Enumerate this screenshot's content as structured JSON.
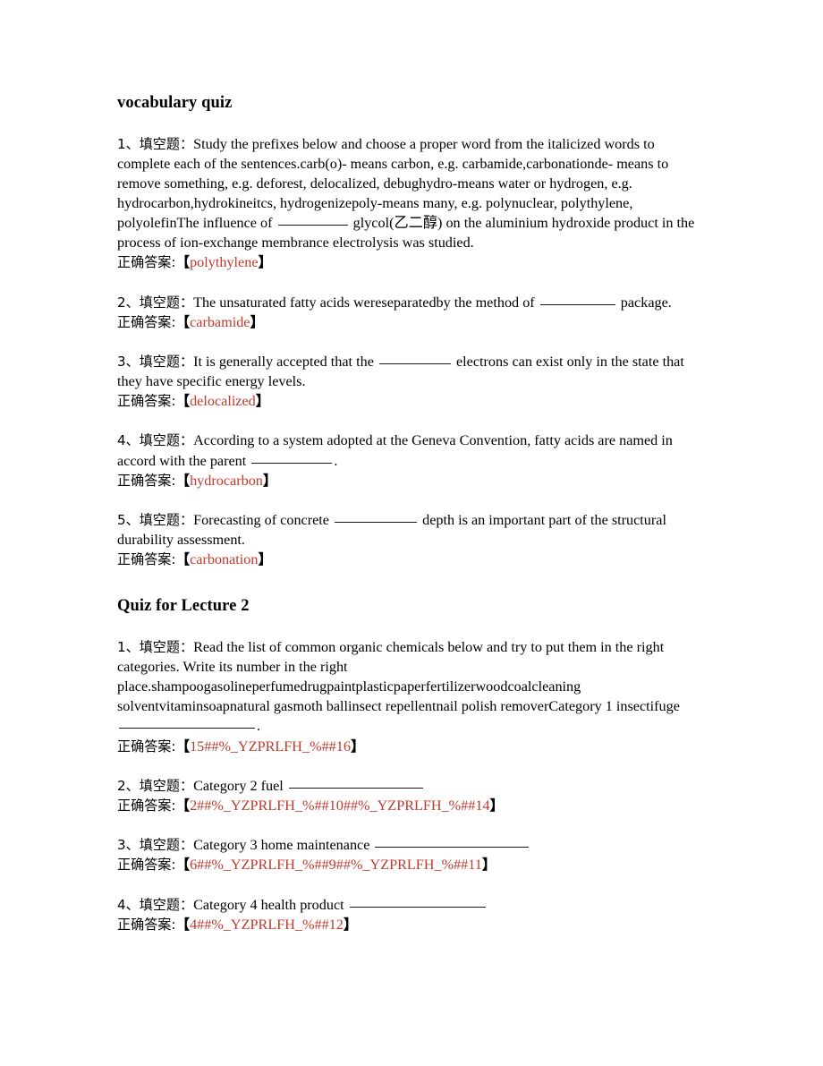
{
  "document": {
    "page_background": "#ffffff",
    "answer_color": "#c0392b",
    "text_color": "#000000",
    "answer_label": "正确答案:",
    "bracket_open": "【",
    "bracket_close": "】"
  },
  "sections": [
    {
      "heading": "vocabulary quiz",
      "questions": [
        {
          "number": "1、填空题：",
          "parts": [
            "Study the prefixes below and choose a proper word from the italicized words to complete each of the sentences.carb(o)- means carbon, e.g. carbamide,carbonationde- means to remove something, e.g. deforest, delocalized, debughydro-means water or hydrogen, e.g. hydrocarbon,hydrokineitcs, hydrogenizepoly-means many, e.g. polynuclear, polythylene, polyolefinThe influence of ",
            " glycol(乙二醇) on the aluminium hydroxide product in the process of ion-exchange membrance electrolysis was studied."
          ],
          "answer": "polythylene"
        },
        {
          "number": "2、填空题：",
          "parts": [
            "The unsaturated fatty acids wereseparatedby the method of ",
            " package."
          ],
          "answer": "carbamide"
        },
        {
          "number": "3、填空题：",
          "parts": [
            "It is generally accepted that the ",
            " electrons can exist only in the state that they have specific energy levels."
          ],
          "answer": "delocalized"
        },
        {
          "number": "4、填空题：",
          "parts": [
            "According to a system adopted at the Geneva Convention, fatty acids are named in accord with the parent ",
            "."
          ],
          "answer": "hydrocarbon"
        },
        {
          "number": "5、填空题：",
          "parts": [
            "Forecasting of concrete ",
            " depth is an important part of the structural durability assessment."
          ],
          "answer": "carbonation"
        }
      ]
    },
    {
      "heading": "Quiz for Lecture 2",
      "questions": [
        {
          "number": "1、填空题：",
          "parts": [
            "Read the list of common organic chemicals below and try to put them in the right categories. Write its number in the right place.shampoogasolineperfumedrugpaintplasticpaperfertilizerwoodcoalcleaning solventvitaminsoapnatural gasmoth ballinsect repellentnail polish removerCategory 1 insectifuge ",
            "."
          ],
          "answer": "15##%_YZPRLFH_%##16"
        },
        {
          "number": "2、填空题：",
          "parts": [
            "Category 2 fuel ",
            ""
          ],
          "answer": "2##%_YZPRLFH_%##10##%_YZPRLFH_%##14"
        },
        {
          "number": "3、填空题：",
          "parts": [
            "Category 3 home maintenance ",
            ""
          ],
          "answer": "6##%_YZPRLFH_%##9##%_YZPRLFH_%##11"
        },
        {
          "number": "4、填空题：",
          "parts": [
            "Category 4 health product ",
            ""
          ],
          "answer": "4##%_YZPRLFH_%##12"
        }
      ]
    }
  ]
}
